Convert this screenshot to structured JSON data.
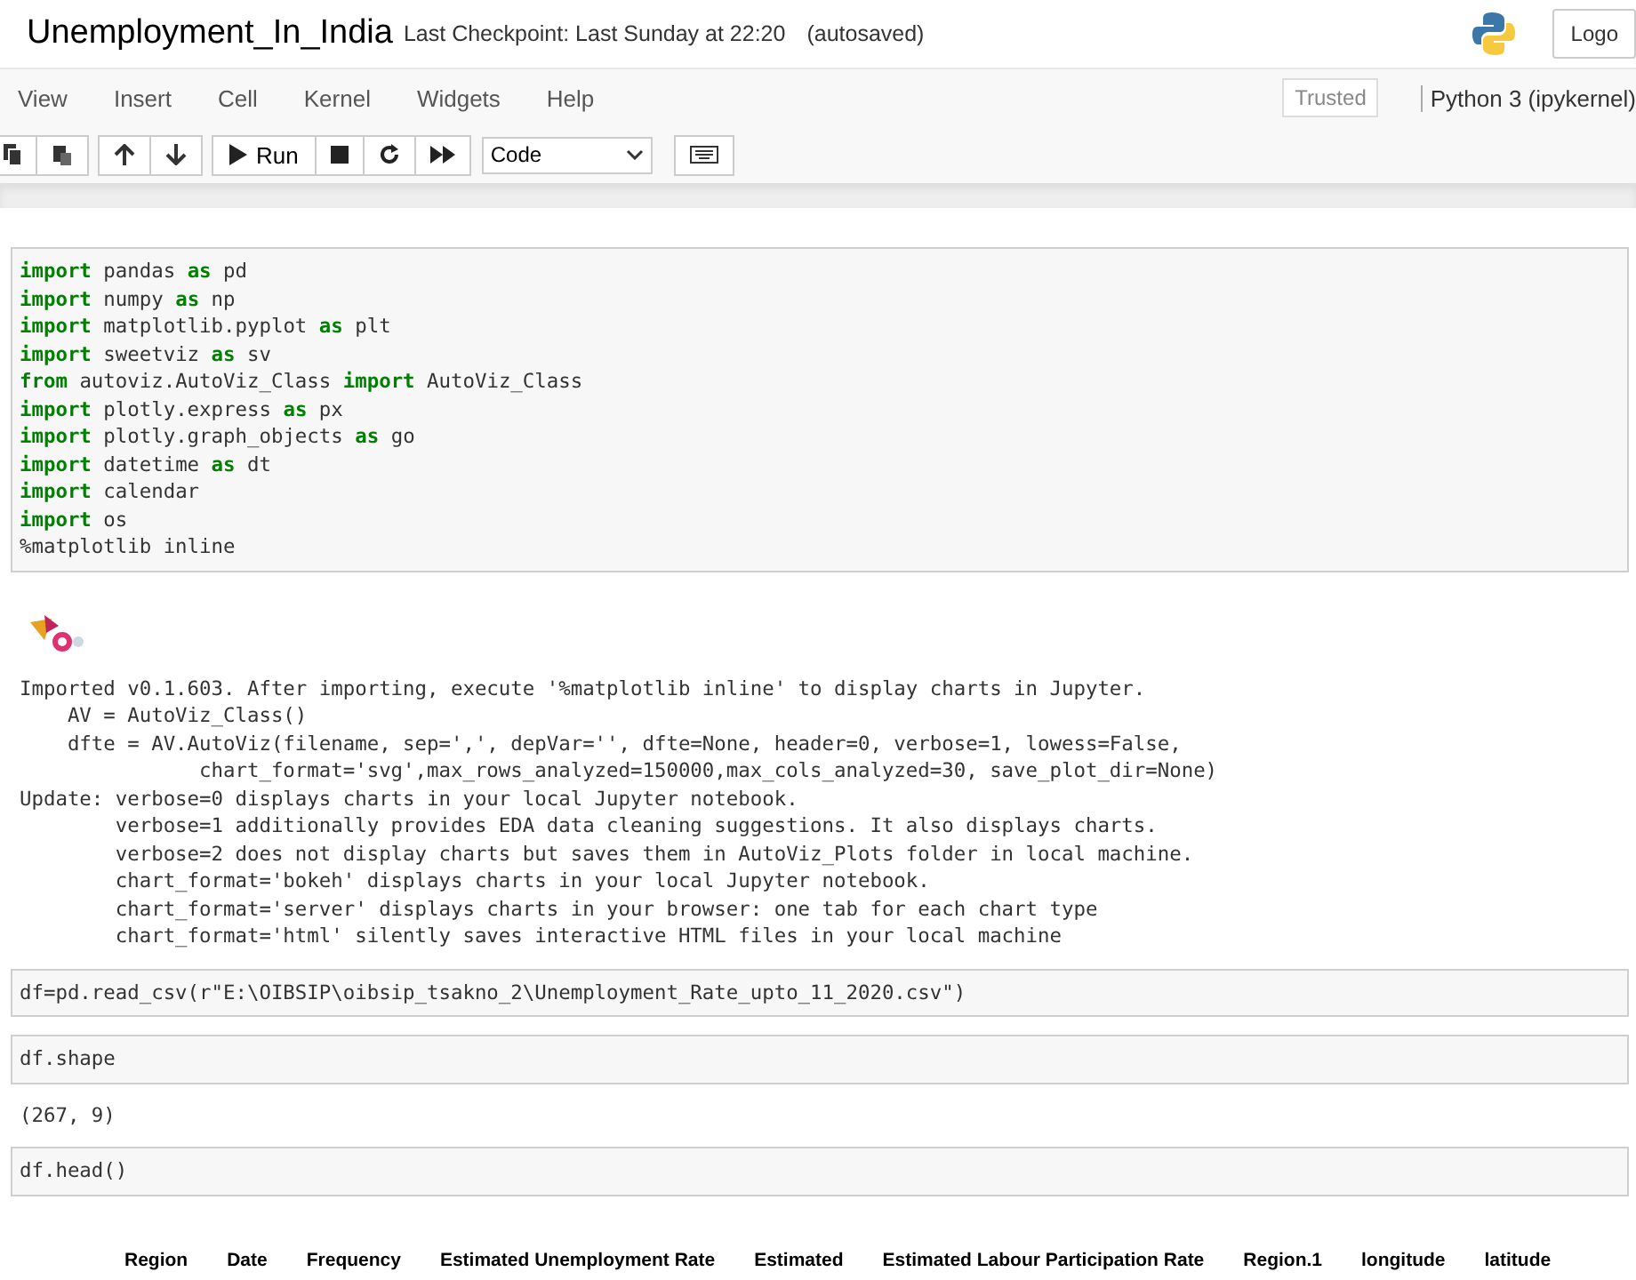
{
  "header": {
    "title": "Unemployment_In_India",
    "checkpoint": "Last Checkpoint: Last Sunday at 22:20",
    "autosave": "(autosaved)",
    "logout": "Logo"
  },
  "menu": {
    "items": [
      "View",
      "Insert",
      "Cell",
      "Kernel",
      "Widgets",
      "Help"
    ],
    "trusted": "Trusted",
    "kernel": "Python 3 (ipykernel)"
  },
  "toolbar": {
    "run": "Run",
    "cell_type": "Code"
  },
  "cells": [
    {
      "kind": "code",
      "lines": [
        "**import** pandas **as** pd",
        "**import** numpy **as** np",
        "**import** matplotlib.pyplot **as** plt",
        "**import** sweetviz **as** sv",
        "**from** autoviz.AutoViz_Class **import** AutoViz_Class",
        "**import** plotly.express **as** px",
        "**import** plotly.graph_objects **as** go",
        "**import** datetime **as** dt",
        "**import** calendar",
        "**import** os",
        "%matplotlib inline"
      ]
    },
    {
      "kind": "logo_output",
      "lines": [
        "Imported v0.1.603. After importing, execute '%matplotlib inline' to display charts in Jupyter.",
        "    AV = AutoViz_Class()",
        "    dfte = AV.AutoViz(filename, sep=',', depVar='', dfte=None, header=0, verbose=1, lowess=False,",
        "               chart_format='svg',max_rows_analyzed=150000,max_cols_analyzed=30, save_plot_dir=None)",
        "Update: verbose=0 displays charts in your local Jupyter notebook.",
        "        verbose=1 additionally provides EDA data cleaning suggestions. It also displays charts.",
        "        verbose=2 does not display charts but saves them in AutoViz_Plots folder in local machine.",
        "        chart_format='bokeh' displays charts in your local Jupyter notebook.",
        "        chart_format='server' displays charts in your browser: one tab for each chart type",
        "        chart_format='html' silently saves interactive HTML files in your local machine"
      ]
    },
    {
      "kind": "code",
      "lines": [
        "df=pd.read_csv(r\"E:\\OIBSIP\\oibsip_tsakno_2\\Unemployment_Rate_upto_11_2020.csv\")"
      ]
    },
    {
      "kind": "code",
      "lines": [
        "df.shape"
      ]
    },
    {
      "kind": "output",
      "lines": [
        "(267, 9)"
      ]
    },
    {
      "kind": "code",
      "lines": [
        "df.head()"
      ]
    },
    {
      "kind": "table_header",
      "columns": [
        "Region",
        "Date",
        "Frequency",
        "Estimated Unemployment Rate",
        "Estimated",
        "Estimated Labour Participation Rate",
        "Region.1",
        "longitude",
        "latitude"
      ]
    }
  ]
}
